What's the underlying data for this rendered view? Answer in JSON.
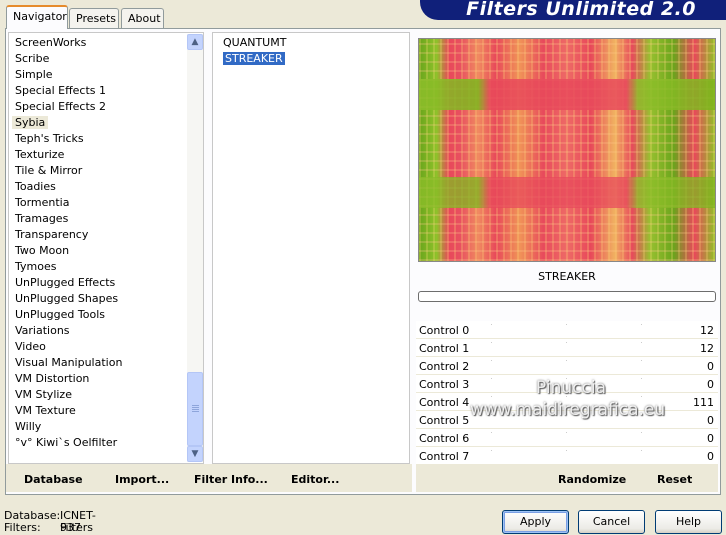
{
  "tabs": [
    "Navigator",
    "Presets",
    "About"
  ],
  "banner_title": "Filters Unlimited 2.0",
  "categories": [
    "ScreenWorks",
    "Scribe",
    "Simple",
    "Special Effects 1",
    "Special Effects 2",
    "Sybia",
    "Teph's Tricks",
    "Texturize",
    "Tile & Mirror",
    "Toadies",
    "Tormentia",
    "Tramages",
    "Transparency",
    "Two Moon",
    "Tymoes",
    "UnPlugged Effects",
    "UnPlugged Shapes",
    "UnPlugged Tools",
    "Variations",
    "Video",
    "Visual Manipulation",
    "VM Distortion",
    "VM Stylize",
    "VM Texture",
    "Willy",
    "°v° Kiwi`s Oelfilter"
  ],
  "selected_category": "Sybia",
  "filters": [
    "QUANTUMT",
    "STREAKER"
  ],
  "selected_filter": "STREAKER",
  "filter_name": "STREAKER",
  "controls": [
    {
      "label": "Control 0",
      "value": "12"
    },
    {
      "label": "Control 1",
      "value": "12"
    },
    {
      "label": "Control 2",
      "value": "0"
    },
    {
      "label": "Control 3",
      "value": "0"
    },
    {
      "label": "Control 4",
      "value": "111"
    },
    {
      "label": "Control 5",
      "value": "0"
    },
    {
      "label": "Control 6",
      "value": "0"
    },
    {
      "label": "Control 7",
      "value": "0"
    }
  ],
  "links": {
    "database": "Database",
    "import": "Import...",
    "filter_info": "Filter Info...",
    "editor": "Editor...",
    "randomize": "Randomize",
    "reset": "Reset"
  },
  "status": {
    "database_label": "Database:",
    "database_value": "ICNET-Filters",
    "filters_label": "Filters:",
    "filters_value": "937"
  },
  "buttons": {
    "apply": "Apply",
    "cancel": "Cancel",
    "help": "Help"
  },
  "watermark": {
    "line1": "Pinuccia",
    "line2": "www.maidiregrafica.eu"
  },
  "colors": {
    "banner": "#10207A",
    "selection": "#316AC5",
    "tab_accent": "#E68B2C"
  }
}
